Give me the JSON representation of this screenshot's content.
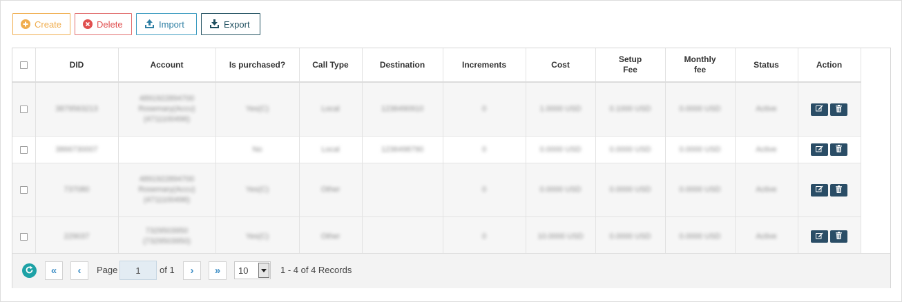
{
  "toolbar": {
    "create_label": "Create",
    "delete_label": "Delete",
    "import_label": "Import",
    "export_label": "Export"
  },
  "table": {
    "headers": [
      "DID",
      "Account",
      "Is purchased?",
      "Call Type",
      "Destination",
      "Increments",
      "Cost",
      "Setup\nFee",
      "Monthly\nfee",
      "Status",
      "Action"
    ],
    "rows": [
      {
        "did": "3879563213",
        "account": [
          "4891922894700",
          "Rosemary(Accu)",
          "(4711100496)"
        ],
        "purchased": "Yes(C)",
        "call_type": "Local",
        "destination": "1236490910",
        "increments": "0",
        "cost": "1.0000 USD",
        "setup_fee": "0.1000 USD",
        "monthly_fee": "0.0000 USD",
        "status": "Active"
      },
      {
        "did": "3866730007",
        "account": [],
        "purchased": "No",
        "call_type": "Local",
        "destination": "1236498790",
        "increments": "0",
        "cost": "0.0000 USD",
        "setup_fee": "0.0000 USD",
        "monthly_fee": "0.0000 USD",
        "status": "Active"
      },
      {
        "did": "737080",
        "account": [
          "4891922894700",
          "Rosemary(Accu)",
          "(4711100496)"
        ],
        "purchased": "Yes(C)",
        "call_type": "Other",
        "destination": "",
        "increments": "0",
        "cost": "0.0000 USD",
        "setup_fee": "0.0000 USD",
        "monthly_fee": "0.0000 USD",
        "status": "Active"
      },
      {
        "did": "229037",
        "account": [
          "7329503950",
          "(7329503950)"
        ],
        "purchased": "Yes(C)",
        "call_type": "Other",
        "destination": "",
        "increments": "0",
        "cost": "10.0000 USD",
        "setup_fee": "0.0000 USD",
        "monthly_fee": "0.0000 USD",
        "status": "Active"
      }
    ]
  },
  "pager": {
    "page_label": "Page",
    "page_value": "1",
    "of_label": "of 1",
    "page_size": "10",
    "records": "1 - 4 of 4 Records",
    "first_glyph": "«",
    "prev_glyph": "‹",
    "next_glyph": "›",
    "last_glyph": "»"
  },
  "colors": {
    "create": "#f0ad4e",
    "delete": "#e04f4f",
    "import": "#2d7ea3",
    "export": "#1f4f5f",
    "action_button": "#2a4d66",
    "refresh": "#1ea2a6",
    "pager_arrow": "#3f8fc6"
  },
  "icons": {
    "create": "plus-circle-icon",
    "delete": "x-circle-icon",
    "import": "upload-tray-icon",
    "export": "download-tray-icon",
    "edit": "edit-icon",
    "remove": "trash-icon",
    "refresh": "refresh-icon",
    "dropdown": "caret-down-icon"
  }
}
